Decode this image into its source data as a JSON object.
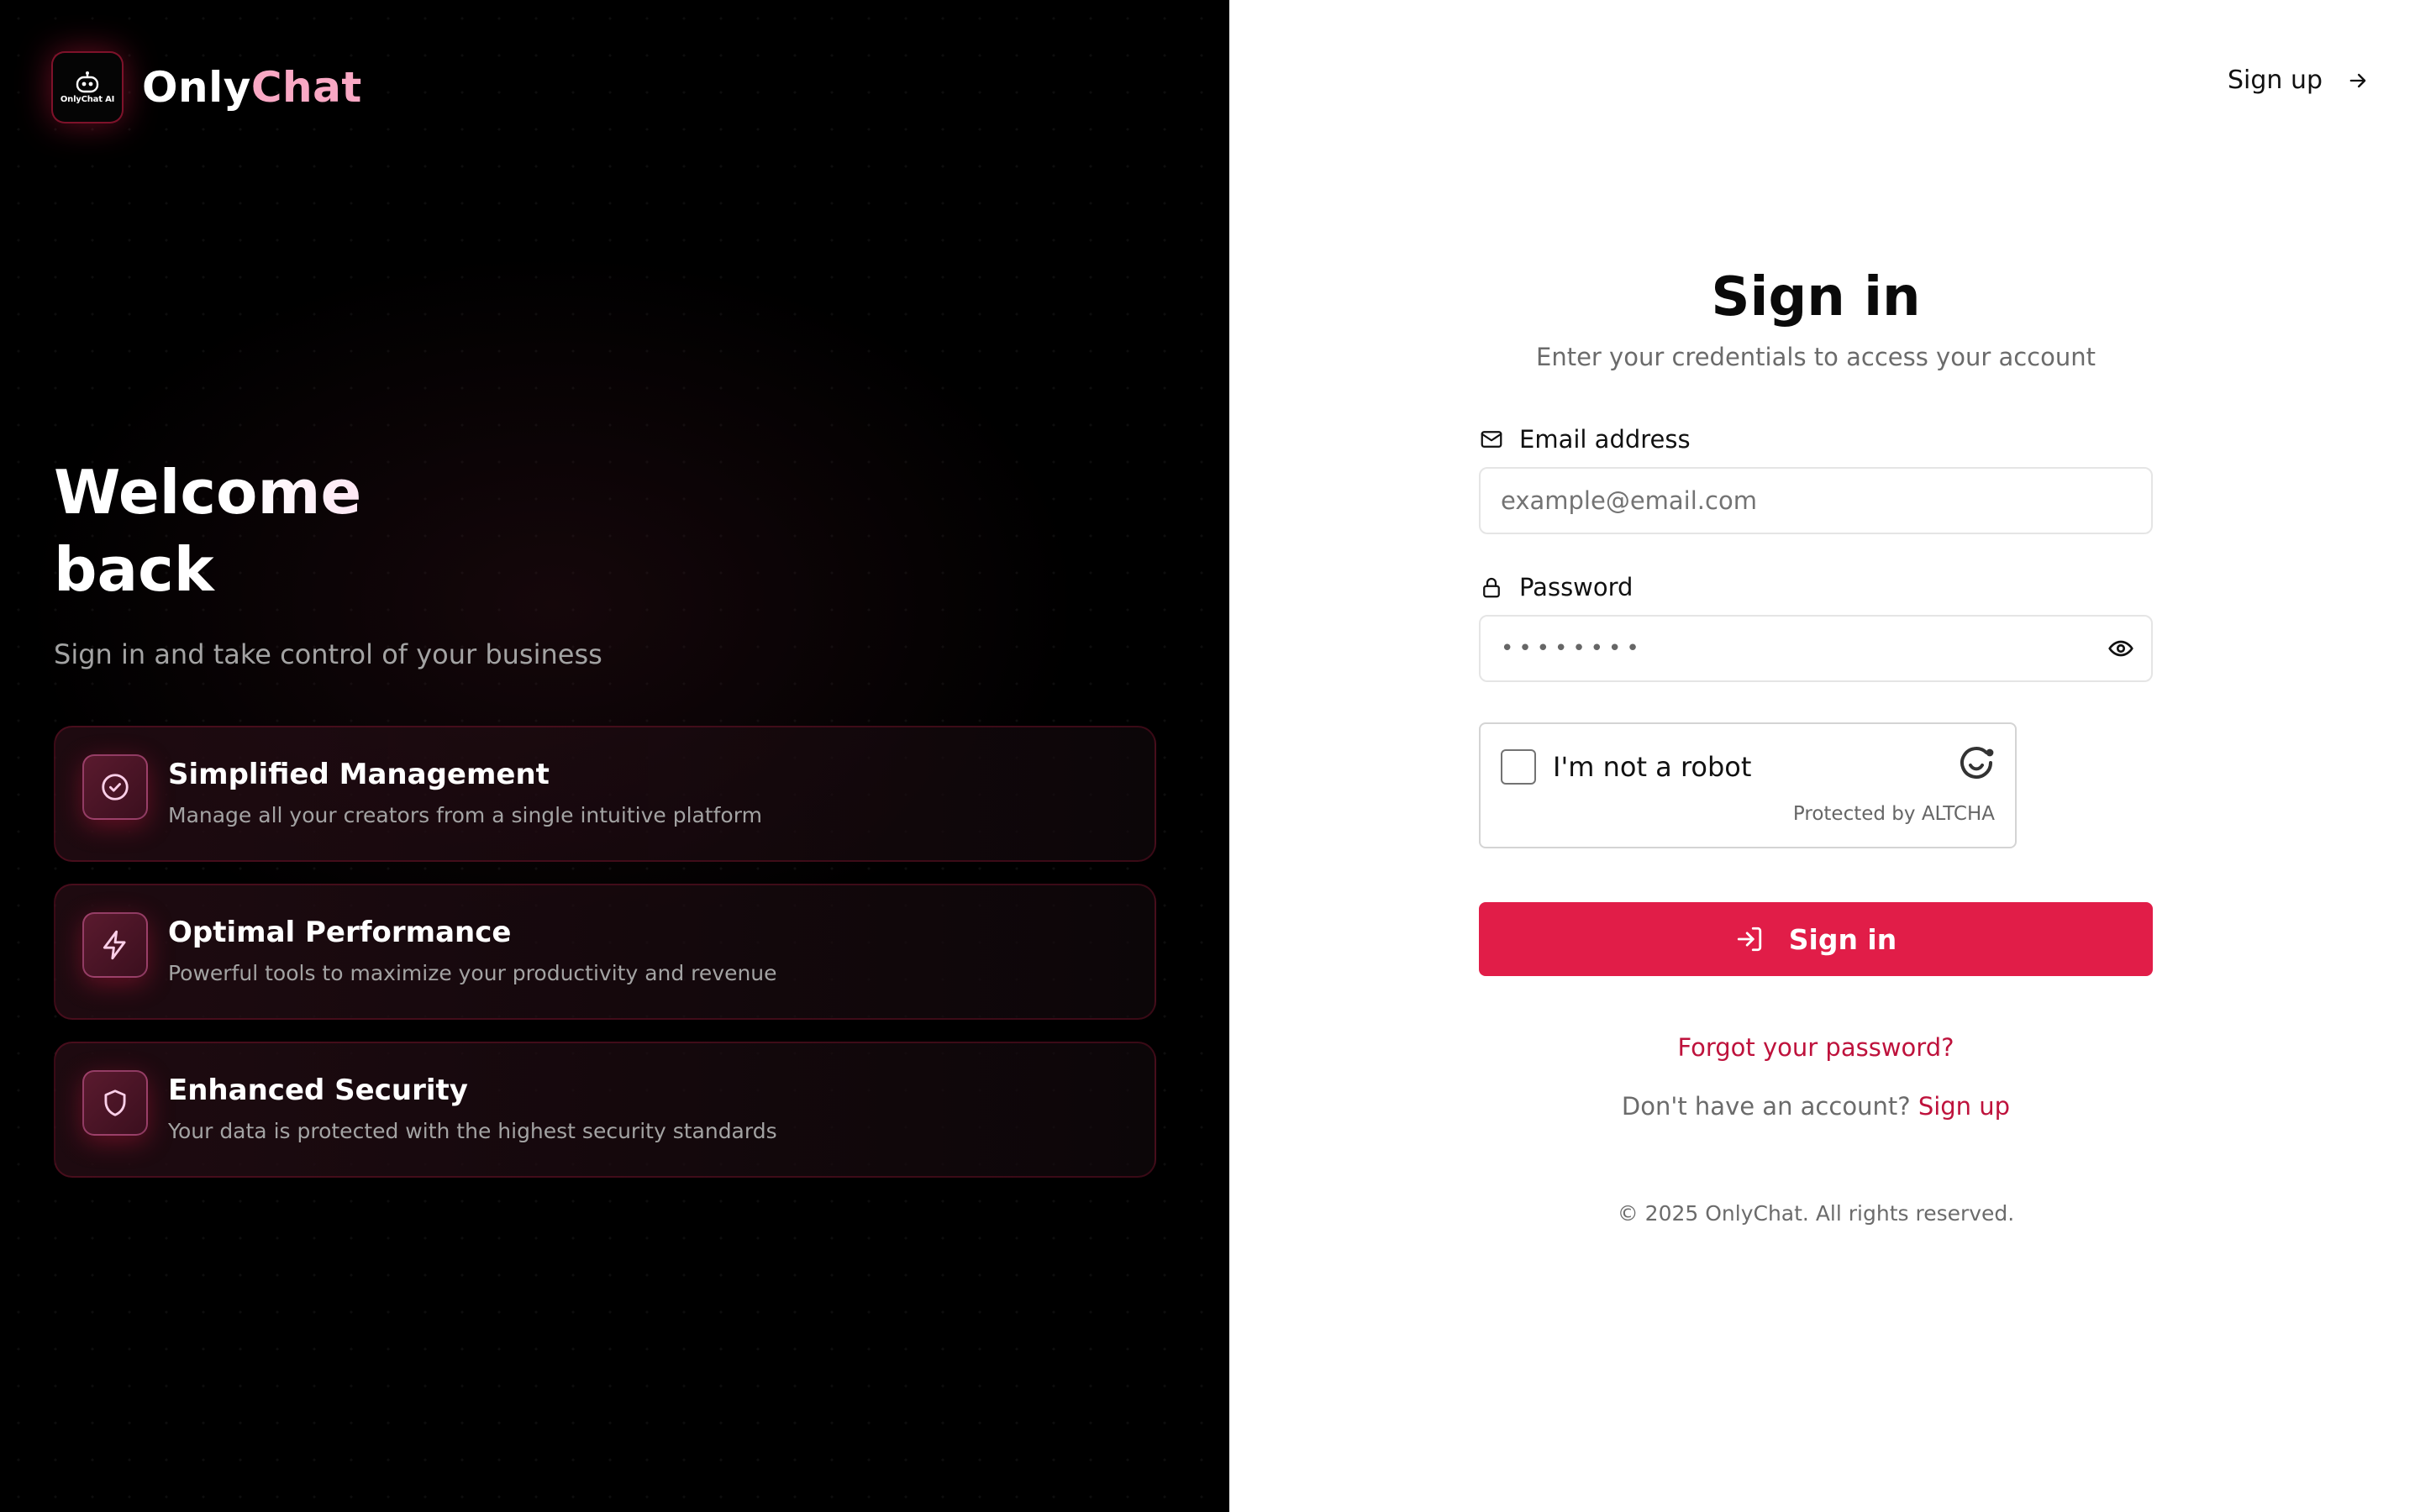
{
  "brand": {
    "name_part1": "Only",
    "name_part2": "Chat",
    "logo_text": "OnlyChat AI"
  },
  "hero": {
    "title_line1": "Welcome",
    "title_line2": "back",
    "subtitle": "Sign in and take control of your business"
  },
  "features": [
    {
      "icon": "check-circle-icon",
      "title": "Simplified Management",
      "description": "Manage all your creators from a single intuitive platform"
    },
    {
      "icon": "lightning-icon",
      "title": "Optimal Performance",
      "description": "Powerful tools to maximize your productivity and revenue"
    },
    {
      "icon": "shield-icon",
      "title": "Enhanced Security",
      "description": "Your data is protected with the highest security standards"
    }
  ],
  "header": {
    "signup_label": "Sign up"
  },
  "form": {
    "title": "Sign in",
    "subtitle": "Enter your credentials to access your account",
    "email_label": "Email address",
    "email_placeholder": "example@email.com",
    "password_label": "Password",
    "password_value": "••••••••",
    "captcha_label": "I'm not a robot",
    "captcha_protected": "Protected by ALTCHA",
    "submit_label": "Sign in",
    "forgot_label": "Forgot your password?",
    "no_account_text": "Don't have an account?",
    "no_account_link": "Sign up",
    "copyright": "© 2025 OnlyChat. All rights reserved."
  },
  "colors": {
    "accent": "#e11d48",
    "link": "#be123c",
    "left_bg": "#000000",
    "brand_pink": "#f9a8c4"
  }
}
